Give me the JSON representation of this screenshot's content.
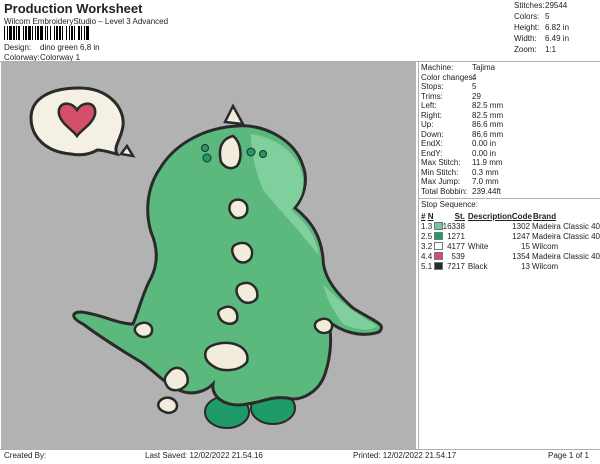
{
  "header": {
    "title": "Production Worksheet",
    "subtitle": "Wilcom EmbroideryStudio – Level 3 Advanced",
    "design_label": "Design:",
    "design_value": "dino green 6,8 in",
    "colorway_label": "Colorway:",
    "colorway_value": "Colorway 1"
  },
  "stats": [
    {
      "label": "Stitches:",
      "value": "29544"
    },
    {
      "label": "Colors:",
      "value": "5"
    },
    {
      "label": "Height:",
      "value": "6.82 in"
    },
    {
      "label": "Width:",
      "value": "6.49 in"
    },
    {
      "label": "Zoom:",
      "value": "1:1"
    }
  ],
  "machine_info": [
    {
      "label": "Machine:",
      "value": "Tajima"
    },
    {
      "label": "Color changes:",
      "value": "4"
    },
    {
      "label": "Stops:",
      "value": "5"
    },
    {
      "label": "Trims:",
      "value": "29"
    },
    {
      "label": "Left:",
      "value": "82.5 mm"
    },
    {
      "label": "Right:",
      "value": "82.5 mm"
    },
    {
      "label": "Up:",
      "value": "86.6 mm"
    },
    {
      "label": "Down:",
      "value": "86.6 mm"
    },
    {
      "label": "EndX:",
      "value": "0.00 in"
    },
    {
      "label": "EndY:",
      "value": "0.00 in"
    },
    {
      "label": "Max Stitch:",
      "value": "11.9 mm"
    },
    {
      "label": "Min Stitch:",
      "value": "0.3 mm"
    },
    {
      "label": "Max Jump:",
      "value": "7.0 mm"
    },
    {
      "label": "Total Bobbin:",
      "value": "239.44ft"
    }
  ],
  "stop_sequence": {
    "title": "Stop Sequence:",
    "columns": [
      "#",
      "N",
      "",
      "St.",
      "Description",
      "Code",
      "Brand"
    ],
    "rows": [
      {
        "num": "1.",
        "n": "3",
        "color": "#6fc89a",
        "stitches": "16338",
        "description": "",
        "code": "1302",
        "brand": "Madeira Classic 40"
      },
      {
        "num": "2.",
        "n": "5",
        "color": "#1f9b6a",
        "stitches": "1271",
        "description": "",
        "code": "1247",
        "brand": "Madeira Classic 40"
      },
      {
        "num": "3.",
        "n": "2",
        "color": "#ffffff",
        "stitches": "4177",
        "description": "White",
        "code": "15",
        "brand": "Wilcom"
      },
      {
        "num": "4.",
        "n": "4",
        "color": "#d4506a",
        "stitches": "539",
        "description": "",
        "code": "1354",
        "brand": "Madeira Classic 40"
      },
      {
        "num": "5.",
        "n": "1",
        "color": "#2a2a2a",
        "stitches": "7217",
        "description": "Black",
        "code": "13",
        "brand": "Wilcom"
      }
    ]
  },
  "footer": {
    "created_by": "Created By:",
    "last_saved": "Last Saved: 12/02/2022 21.54.16",
    "printed": "Printed: 12/02/2022 21.54.17",
    "page": "Page 1 of 1"
  },
  "colors": {
    "canvas": "#b2b2b2",
    "dino_main": "#5cb97d",
    "dino_light": "#7fd09c",
    "dino_dark": "#1f9b6a",
    "outline": "#2a2a2a",
    "heart": "#d4506a",
    "spikes": "#f2ecdc"
  }
}
